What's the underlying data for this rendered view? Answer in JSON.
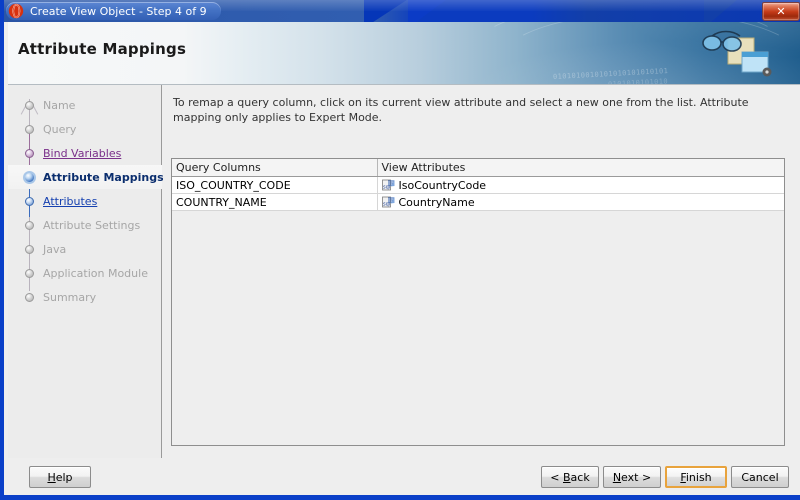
{
  "window": {
    "title": "Create View Object - Step 4 of 9",
    "app_icon": "oracle-jdeveloper-icon",
    "close_label": "✕"
  },
  "header": {
    "page_title": "Attribute Mappings",
    "binary_line_1": "0101010010101010101010101",
    "binary_line_2": "0101010101010",
    "art_icon": "glasses-and-window-icon"
  },
  "sidebar": {
    "steps": [
      {
        "label": "Name",
        "state": "done"
      },
      {
        "label": "Query",
        "state": "done"
      },
      {
        "label": "Bind Variables",
        "state": "visited"
      },
      {
        "label": "Attribute Mappings",
        "state": "active"
      },
      {
        "label": "Attributes",
        "state": "next"
      },
      {
        "label": "Attribute Settings",
        "state": "disabled"
      },
      {
        "label": "Java",
        "state": "disabled"
      },
      {
        "label": "Application Module",
        "state": "disabled"
      },
      {
        "label": "Summary",
        "state": "disabled"
      }
    ]
  },
  "content": {
    "instructions": "To remap a query column, click on its current view attribute and select a new one from the list.  Attribute mapping only applies to Expert Mode.",
    "table": {
      "columns": [
        "Query Columns",
        "View Attributes"
      ],
      "rows": [
        {
          "query_column": "ISO_COUNTRY_CODE",
          "view_attribute": "IsoCountryCode",
          "icon": "sql-attribute-icon"
        },
        {
          "query_column": "COUNTRY_NAME",
          "view_attribute": "CountryName",
          "icon": "sql-attribute-icon"
        }
      ]
    }
  },
  "footer": {
    "help": "Help",
    "back": "< Back",
    "next": "Next >",
    "finish": "Finish",
    "cancel": "Cancel"
  },
  "colors": {
    "window_border": "#0a3fc8",
    "title_bar": "#2f5cae",
    "active_step": "#0b2e6e",
    "visited_link": "#7a2f8a",
    "next_link": "#1540b0",
    "default_button_focus": "#e8a33d"
  }
}
